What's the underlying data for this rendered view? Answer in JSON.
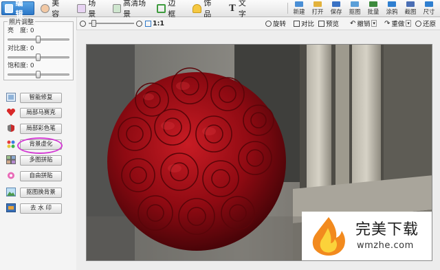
{
  "tabs": [
    {
      "label": "编 辑",
      "icon": "edit-icon",
      "active": true
    },
    {
      "label": "美 容",
      "icon": "face-icon"
    },
    {
      "label": "场 景",
      "icon": "scene-icon"
    },
    {
      "label": "高清场景",
      "icon": "hd-scene-icon"
    },
    {
      "label": "边 框",
      "icon": "frame-icon"
    },
    {
      "label": "饰 品",
      "icon": "ornament-icon"
    },
    {
      "label": "文 字",
      "icon": "text-icon"
    }
  ],
  "tools": [
    {
      "label": "新建",
      "icon": "new-icon",
      "color": "#4a8fd6"
    },
    {
      "label": "打开",
      "icon": "open-icon",
      "color": "#e3b23c"
    },
    {
      "label": "保存",
      "icon": "save-icon",
      "color": "#3a72c4"
    },
    {
      "label": "抠图",
      "icon": "cutout-icon",
      "color": "#5a9fd8"
    },
    {
      "label": "批量",
      "icon": "batch-icon",
      "color": "#3c8a3c"
    },
    {
      "label": "涂鸦",
      "icon": "doodle-icon",
      "color": "#2f7fd0"
    },
    {
      "label": "截图",
      "icon": "screenshot-icon",
      "color": "#4b6fb5"
    },
    {
      "label": "尺寸",
      "icon": "resize-icon",
      "color": "#2f7fd0"
    }
  ],
  "subbar": {
    "zoom_label": "1:1",
    "rotate": "旋转",
    "contrast": "对比",
    "preview": "预览",
    "undo": "撤销",
    "redo": "重做",
    "restore": "还原"
  },
  "adjust": {
    "title": "照片调整",
    "brightness_label": "亮　度:",
    "brightness_value": "0",
    "contrast_label": "对比度:",
    "contrast_value": "0",
    "saturation_label": "饱和度:",
    "saturation_value": "0"
  },
  "functions": [
    {
      "label": "智能修复",
      "icon": "smart-repair-icon"
    },
    {
      "label": "局部马赛克",
      "icon": "mosaic-icon"
    },
    {
      "label": "局部彩色笔",
      "icon": "color-pen-icon"
    },
    {
      "label": "背景虚化",
      "icon": "blur-icon"
    },
    {
      "label": "多图拼贴",
      "icon": "collage-icon"
    },
    {
      "label": "自由拼贴",
      "icon": "free-collage-icon"
    },
    {
      "label": "抠图换背景",
      "icon": "background-swap-icon"
    },
    {
      "label": "去 水 印",
      "icon": "remove-watermark-icon"
    }
  ],
  "watermark": {
    "main": "完美下载",
    "sub": "wmzhe.com"
  },
  "colors": {
    "accent": "#2b77c8",
    "highlight": "#d43ad4",
    "rose": "#9e0c14"
  }
}
